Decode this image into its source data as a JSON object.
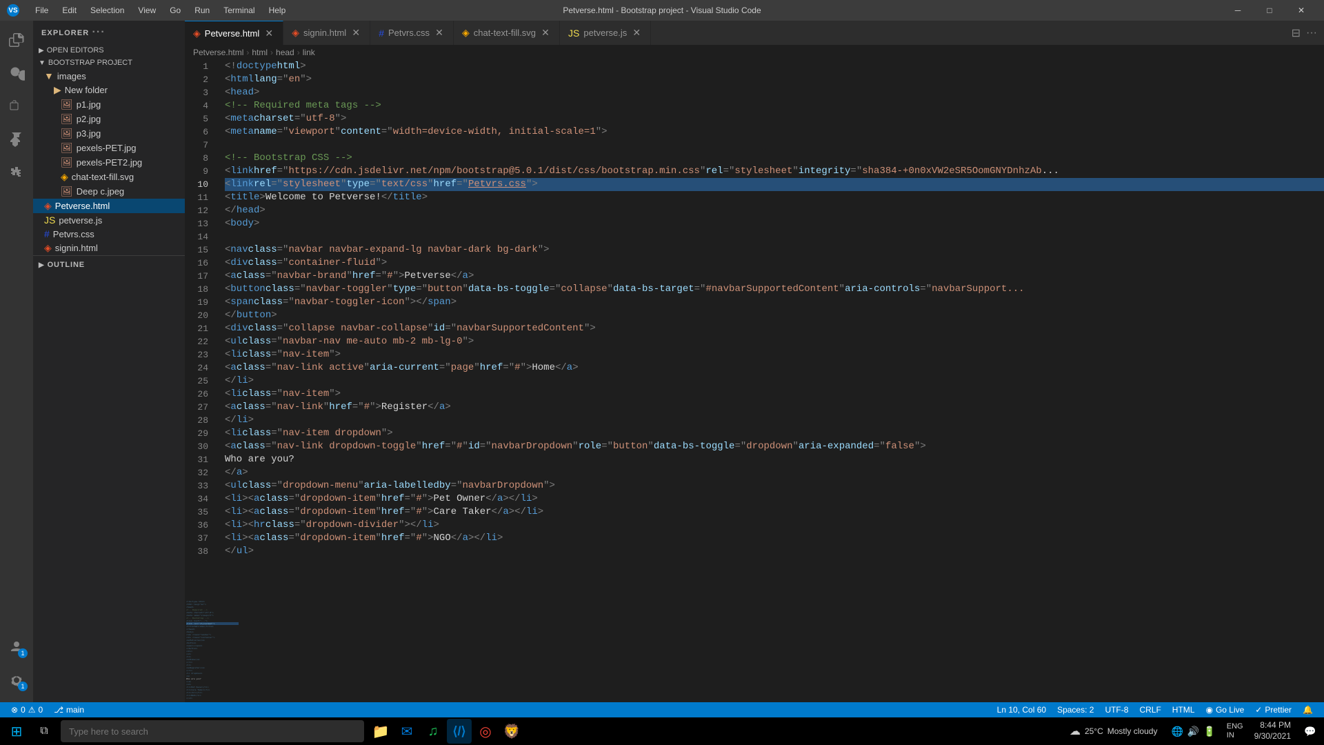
{
  "titleBar": {
    "menu": [
      "File",
      "Edit",
      "Selection",
      "View",
      "Go",
      "Run",
      "Terminal",
      "Help"
    ],
    "title": "Petverse.html - Bootstrap project - Visual Studio Code",
    "controls": [
      "─",
      "□",
      "✕"
    ]
  },
  "tabs": [
    {
      "id": "petverse",
      "label": "Petverse.html",
      "type": "html",
      "active": true,
      "modified": false
    },
    {
      "id": "signin",
      "label": "signin.html",
      "type": "html",
      "active": false
    },
    {
      "id": "petvrs",
      "label": "Petvrs.css",
      "type": "css",
      "active": false
    },
    {
      "id": "chat-svg",
      "label": "chat-text-fill.svg",
      "type": "svg",
      "active": false
    },
    {
      "id": "petverse-js",
      "label": "petverse.js",
      "type": "js",
      "active": false
    }
  ],
  "breadcrumb": [
    "Petverse.html",
    "html",
    "head",
    "link"
  ],
  "sidebar": {
    "title": "EXPLORER",
    "sections": {
      "openEditors": "OPEN EDITORS",
      "bootstrapProject": "BOOTSTRAP PROJECT"
    },
    "tree": [
      {
        "type": "folder",
        "name": "images",
        "indent": 0
      },
      {
        "type": "folder",
        "name": "New folder",
        "indent": 1
      },
      {
        "type": "file",
        "name": "p1.jpg",
        "indent": 1,
        "icon": "image"
      },
      {
        "type": "file",
        "name": "p2.jpg",
        "indent": 1,
        "icon": "image"
      },
      {
        "type": "file",
        "name": "p3.jpg",
        "indent": 1,
        "icon": "image"
      },
      {
        "type": "file",
        "name": "pexels-PET.jpg",
        "indent": 1,
        "icon": "image"
      },
      {
        "type": "file",
        "name": "pexels-PET2.jpg",
        "indent": 1,
        "icon": "image"
      },
      {
        "type": "file",
        "name": "chat-text-fill.svg",
        "indent": 1,
        "icon": "svg"
      },
      {
        "type": "file",
        "name": "Deep c.jpeg",
        "indent": 1,
        "icon": "image"
      },
      {
        "type": "file",
        "name": "Petverse.html",
        "indent": 0,
        "icon": "html",
        "active": true
      },
      {
        "type": "file",
        "name": "petverse.js",
        "indent": 0,
        "icon": "js"
      },
      {
        "type": "file",
        "name": "Petvrs.css",
        "indent": 0,
        "icon": "css"
      },
      {
        "type": "file",
        "name": "signin.html",
        "indent": 0,
        "icon": "html"
      }
    ],
    "outline": "OUTLINE"
  },
  "editor": {
    "currentLine": 10,
    "currentCol": 60,
    "lines": [
      {
        "num": 1,
        "content": "<!doctype html>"
      },
      {
        "num": 2,
        "content": "<html lang=\"en\">"
      },
      {
        "num": 3,
        "content": "  <head>"
      },
      {
        "num": 4,
        "content": "    <!-- Required meta tags -->"
      },
      {
        "num": 5,
        "content": "    <meta charset=\"utf-8\">"
      },
      {
        "num": 6,
        "content": "    <meta name=\"viewport\" content=\"width=device-width, initial-scale=1\">"
      },
      {
        "num": 7,
        "content": ""
      },
      {
        "num": 8,
        "content": "    <!-- Bootstrap CSS -->"
      },
      {
        "num": 9,
        "content": "    <link href=\"https://cdn.jsdelivr.net/npm/bootstrap@5.0.1/dist/css/bootstrap.min.css\" rel=\"stylesheet\" integrity=\"sha384-+0n0xVW2eSR5OomGNYDnhzAb"
      },
      {
        "num": 10,
        "content": "    <link rel=\"stylesheet\" type=\"text/css\" href=\"Petvrs.css\">",
        "highlighted": true
      },
      {
        "num": 11,
        "content": "    <title>Welcome to Petverse!</title>"
      },
      {
        "num": 12,
        "content": "  </head>"
      },
      {
        "num": 13,
        "content": "  <body>"
      },
      {
        "num": 14,
        "content": ""
      },
      {
        "num": 15,
        "content": "    <nav class=\"navbar navbar-expand-lg navbar-dark bg-dark\">"
      },
      {
        "num": 16,
        "content": "      <div class=\"container-fluid\">"
      },
      {
        "num": 17,
        "content": "        <a class=\"navbar-brand\" href=\"#\">Petverse</a>"
      },
      {
        "num": 18,
        "content": "        <button class=\"navbar-toggler\" type=\"button\" data-bs-toggle=\"collapse\" data-bs-target=\"#navbarSupportedContent\" aria-controls=\"navbarSupport"
      },
      {
        "num": 19,
        "content": "          <span class=\"navbar-toggler-icon\"></span>"
      },
      {
        "num": 20,
        "content": "        </button>"
      },
      {
        "num": 21,
        "content": "        <div class=\"collapse navbar-collapse\" id=\"navbarSupportedContent\">"
      },
      {
        "num": 22,
        "content": "          <ul class=\"navbar-nav me-auto mb-2 mb-lg-0\">"
      },
      {
        "num": 23,
        "content": "            <li class=\"nav-item\">"
      },
      {
        "num": 24,
        "content": "              <a class=\"nav-link active\" aria-current=\"page\" href=\"#\">Home</a>"
      },
      {
        "num": 25,
        "content": "            </li>"
      },
      {
        "num": 26,
        "content": "            <li class=\"nav-item\">"
      },
      {
        "num": 27,
        "content": "              <a class=\"nav-link\" href=\"#\">Register</a>"
      },
      {
        "num": 28,
        "content": "            </li>"
      },
      {
        "num": 29,
        "content": "            <li class=\"nav-item dropdown\">"
      },
      {
        "num": 30,
        "content": "              <a class=\"nav-link dropdown-toggle\" href=\"#\" id=\"navbarDropdown\" role=\"button\" data-bs-toggle=\"dropdown\" aria-expanded=\"false\">"
      },
      {
        "num": 31,
        "content": "                Who are you?"
      },
      {
        "num": 32,
        "content": "              </a>"
      },
      {
        "num": 33,
        "content": "              <ul class=\"dropdown-menu\" aria-labelledby=\"navbarDropdown\">"
      },
      {
        "num": 34,
        "content": "                <li><a class=\"dropdown-item\" href=\"#\">Pet Owner</a></li>"
      },
      {
        "num": 35,
        "content": "                <li><a class=\"dropdown-item\" href=\"#\">Care Taker</a></li>"
      },
      {
        "num": 36,
        "content": "                <li><hr class=\"dropdown-divider\"></li>"
      },
      {
        "num": 37,
        "content": "                <li><a class=\"dropdown-item\" href=\"#\">NGO</a></li>"
      },
      {
        "num": 38,
        "content": "              </ul>"
      }
    ]
  },
  "statusBar": {
    "errors": "0",
    "warnings": "0",
    "branch": "main",
    "lineCol": "Ln 10, Col 60",
    "spaces": "Spaces: 2",
    "encoding": "UTF-8",
    "lineEnding": "CRLF",
    "language": "HTML",
    "goLive": "Go Live",
    "prettier": "Prettier"
  },
  "taskbar": {
    "searchPlaceholder": "Type here to search",
    "weather": {
      "temp": "25°C",
      "condition": "Mostly cloudy"
    },
    "time": "8:44 PM",
    "date": "9/30/2021",
    "lang": "ENG\nIN"
  }
}
